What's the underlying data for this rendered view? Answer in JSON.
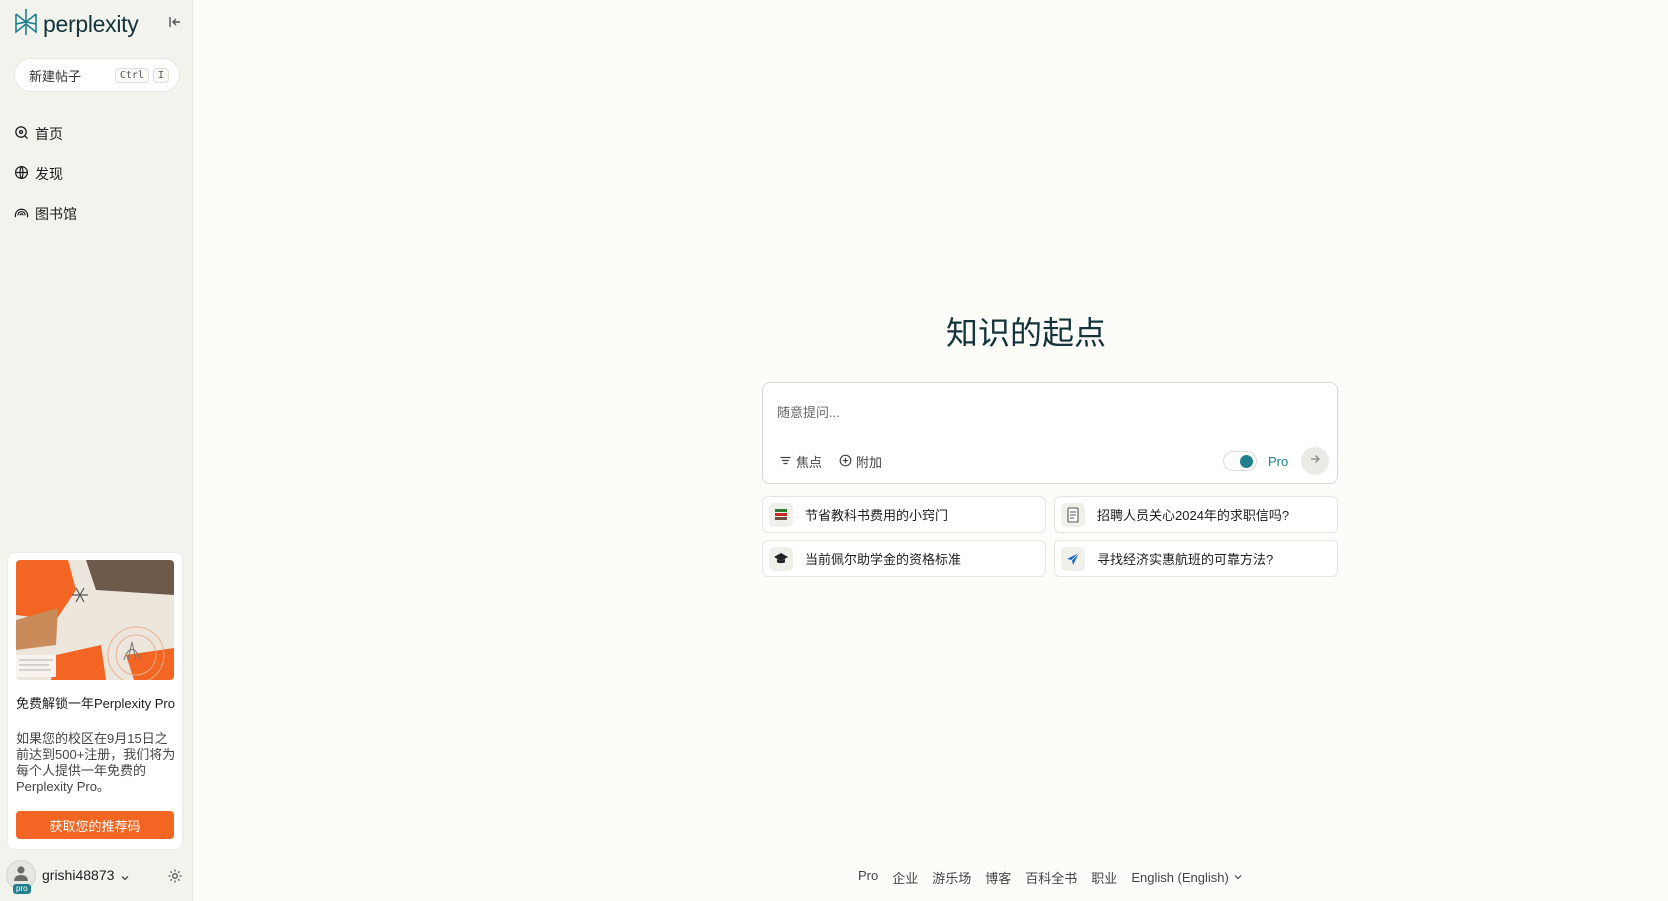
{
  "brand": {
    "name": "perplexity"
  },
  "sidebar": {
    "new_thread": {
      "label": "新建帖子",
      "kbd_ctrl": "Ctrl",
      "kbd_key": "I"
    },
    "items": [
      {
        "label": "首页",
        "icon": "home-icon"
      },
      {
        "label": "发现",
        "icon": "globe-icon"
      },
      {
        "label": "图书馆",
        "icon": "library-icon"
      }
    ],
    "promo": {
      "title": "免费解锁一年Perplexity Pro",
      "text": "如果您的校区在9月15日之前达到500+注册，我们将为每个人提供一年免费的Perplexity Pro。",
      "button": "获取您的推荐码"
    },
    "user": {
      "name": "grishi48873",
      "badge": "pro"
    }
  },
  "main": {
    "title": "知识的起点",
    "ask": {
      "placeholder": "随意提问...",
      "focus_label": "焦点",
      "attach_label": "附加",
      "pro_label": "Pro"
    },
    "suggestions": [
      {
        "text": "节省教科书费用的小窍门",
        "icon": "books-icon"
      },
      {
        "text": "招聘人员关心2024年的求职信吗?",
        "icon": "document-icon"
      },
      {
        "text": "当前佩尔助学金的资格标准",
        "icon": "graduation-cap-icon"
      },
      {
        "text": "寻找经济实惠航班的可靠方法?",
        "icon": "airplane-icon"
      }
    ]
  },
  "footer": {
    "links": [
      "Pro",
      "企业",
      "游乐场",
      "博客",
      "百科全书",
      "职业"
    ],
    "language": "English (English)"
  },
  "colors": {
    "accent": "#20808d",
    "promo_button": "#f26522",
    "background": "#fcfcf9",
    "sidebar": "#f3f3ee"
  }
}
